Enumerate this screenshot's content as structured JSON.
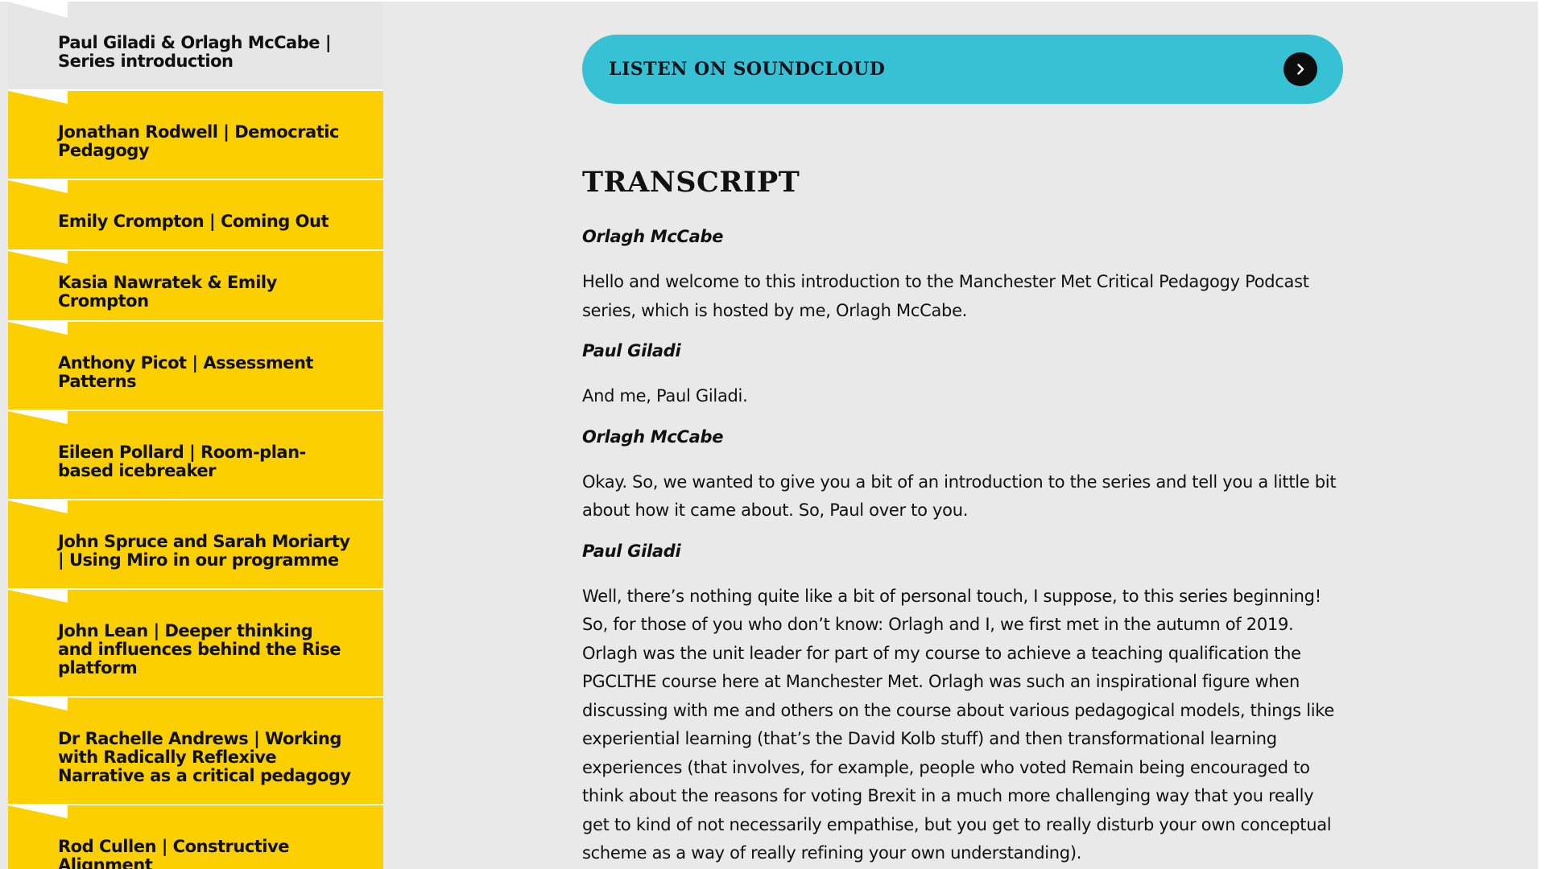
{
  "sidebar": {
    "items": [
      {
        "label": "Paul Giladi & Orlagh McCabe | Series introduction"
      },
      {
        "label": "Jonathan Rodwell | Democratic Pedagogy"
      },
      {
        "label": "Emily Crompton | Coming Out"
      },
      {
        "label": "Kasia Nawratek & Emily Crompton"
      },
      {
        "label": "Anthony Picot | Assessment Patterns"
      },
      {
        "label": "Eileen Pollard | Room-plan-based icebreaker"
      },
      {
        "label": "John Spruce and Sarah Moriarty | Using Miro in our programme"
      },
      {
        "label": "John Lean | Deeper thinking and influences behind the Rise platform"
      },
      {
        "label": "Dr Rachelle Andrews | Working with Radically Reflexive Narrative as a critical pedagogy"
      },
      {
        "label": "Rod Cullen | Constructive Alignment"
      }
    ]
  },
  "main": {
    "listen_button": {
      "label": "LISTEN ON SOUNDCLOUD",
      "icon": "chevron-right-icon"
    },
    "heading": "TRANSCRIPT",
    "transcript": [
      {
        "speaker": "Orlagh McCabe",
        "text": "Hello and welcome to this introduction to the Manchester Met Critical Pedagogy Podcast series, which is hosted by me, Orlagh McCabe."
      },
      {
        "speaker": "Paul Giladi",
        "text": "And me, Paul Giladi."
      },
      {
        "speaker": "Orlagh McCabe",
        "text": "Okay. So, we wanted to give you a bit of an introduction to the series and tell you a little bit about how it came about. So, Paul over to you."
      },
      {
        "speaker": "Paul Giladi",
        "text": "Well, there’s nothing quite like a bit of personal touch, I suppose, to this series beginning! So, for those of you who don’t know: Orlagh and I, we first met in the autumn of 2019. Orlagh was the unit leader for part of my course to achieve a teaching qualification the PGCLTHE course here at Manchester Met. Orlagh was such an inspirational figure when discussing with me and others on the course about various pedagogical models, things like experiential learning (that’s the David Kolb stuff) and then transformational learning experiences (that involves, for example, people who voted Remain being encouraged to think about the reasons for voting Brexit in a much more challenging way that you really get to kind of not necessarily empathise, but you get to really disturb your own conceptual scheme as a way of really refining your own understanding)."
      }
    ]
  },
  "colors": {
    "sidebar_item_bg": "#fbcf00",
    "sidebar_current_bg": "#e6e6e6",
    "listen_button_bg": "#36c1d4",
    "page_bg": "#e9e9e9"
  }
}
